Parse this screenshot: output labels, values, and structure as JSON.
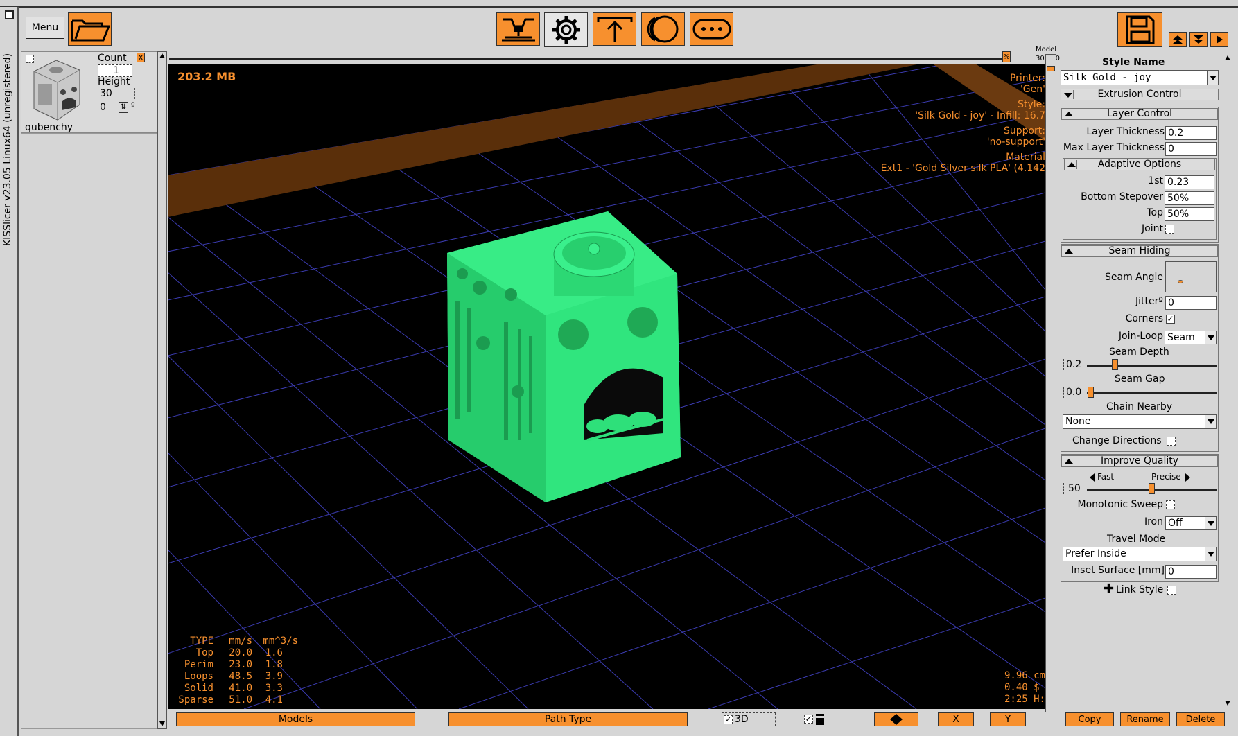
{
  "app": {
    "vertical_title": "KISSlicer v23.05 Linux64 (unregistered)",
    "menu_label": "Menu"
  },
  "toolbar": {
    "icons": [
      "open-folder-icon",
      "printer-icon",
      "gear-icon",
      "support-icon",
      "material-icon",
      "more-icon",
      "save-icon"
    ]
  },
  "models_panel": {
    "model_name": "qubenchy",
    "count_label": "Count",
    "count_value": "1",
    "height_label": "Height",
    "height_value": "30",
    "rotation_value": "0",
    "degree_symbol": "º",
    "close_mark": "X"
  },
  "viewport": {
    "memory": "203.2 MB",
    "model_height_label": "Model",
    "model_height_value": "30.030",
    "percent_marker": "%",
    "info": {
      "printer_label": "Printer:",
      "printer_value": "'Gen'",
      "style_label": "Style:",
      "style_value": "'Silk Gold - joy' - Infill: 16.7",
      "support_label": "Support:",
      "support_value": "'no-support'",
      "material_label": "Material",
      "material_value": "Ext1 - 'Gold Silver silk PLA' (4.142"
    },
    "speed_table": {
      "headers": [
        "TYPE",
        "mm/s",
        "mm^3/s"
      ],
      "rows": [
        [
          "Top",
          "20.0",
          "1.6"
        ],
        [
          "Perim",
          "23.0",
          "1.8"
        ],
        [
          "Loops",
          "48.5",
          "3.9"
        ],
        [
          "Solid",
          "41.0",
          "3.3"
        ],
        [
          "Sparse",
          "51.0",
          "4.1"
        ]
      ]
    },
    "stats": [
      "9.96 cm",
      "0.40 $",
      "2:25 H:"
    ]
  },
  "bottom": {
    "models_btn": "Models",
    "path_type_btn": "Path Type",
    "view3d_label": "3D",
    "x_btn": "X",
    "y_btn": "Y",
    "copy_btn": "Copy",
    "rename_btn": "Rename",
    "delete_btn": "Delete"
  },
  "style_panel": {
    "style_name_label": "Style Name",
    "style_name_value": "Silk Gold - joy",
    "extrusion_control": "Extrusion Control",
    "layer_control": "Layer Control",
    "layer_thickness_label": "Layer Thickness",
    "layer_thickness_value": "0.2",
    "max_layer_thickness_label": "Max Layer Thickness",
    "max_layer_thickness_value": "0",
    "adaptive_options": "Adaptive Options",
    "first_label": "1st",
    "first_value": "0.23",
    "bottom_stepover_label": "Bottom Stepover",
    "bottom_stepover_value": "50%",
    "top_label": "Top",
    "top_value": "50%",
    "joint_label": "Joint",
    "seam_hiding": "Seam Hiding",
    "seam_angle_label": "Seam Angle",
    "jitter_label": "Jitterº",
    "jitter_value": "0",
    "corners_label": "Corners",
    "corners_mark": "✓",
    "join_loop_label": "Join-Loop",
    "join_loop_value": "Seam",
    "seam_depth_label": "Seam Depth",
    "seam_depth_value": "0.2",
    "seam_gap_label": "Seam Gap",
    "seam_gap_value": "0.0",
    "chain_nearby_label": "Chain Nearby",
    "chain_nearby_value": "None",
    "change_directions_label": "Change Directions",
    "improve_quality": "Improve Quality",
    "fast_label": "Fast",
    "precise_label": "Precise",
    "quality_value": "50",
    "monotonic_sweep_label": "Monotonic Sweep",
    "iron_label": "Iron",
    "iron_value": "Off",
    "travel_mode_label": "Travel Mode",
    "travel_mode_value": "Prefer Inside",
    "inset_surface_label": "Inset Surface [mm]",
    "inset_surface_value": "0",
    "link_style_label": "Link Style",
    "link_plus": "✚"
  },
  "colors": {
    "accent": "#f7902e",
    "model": "#2fe07a",
    "grid": "#3b3bb0",
    "viewport_bg": "#000000"
  }
}
